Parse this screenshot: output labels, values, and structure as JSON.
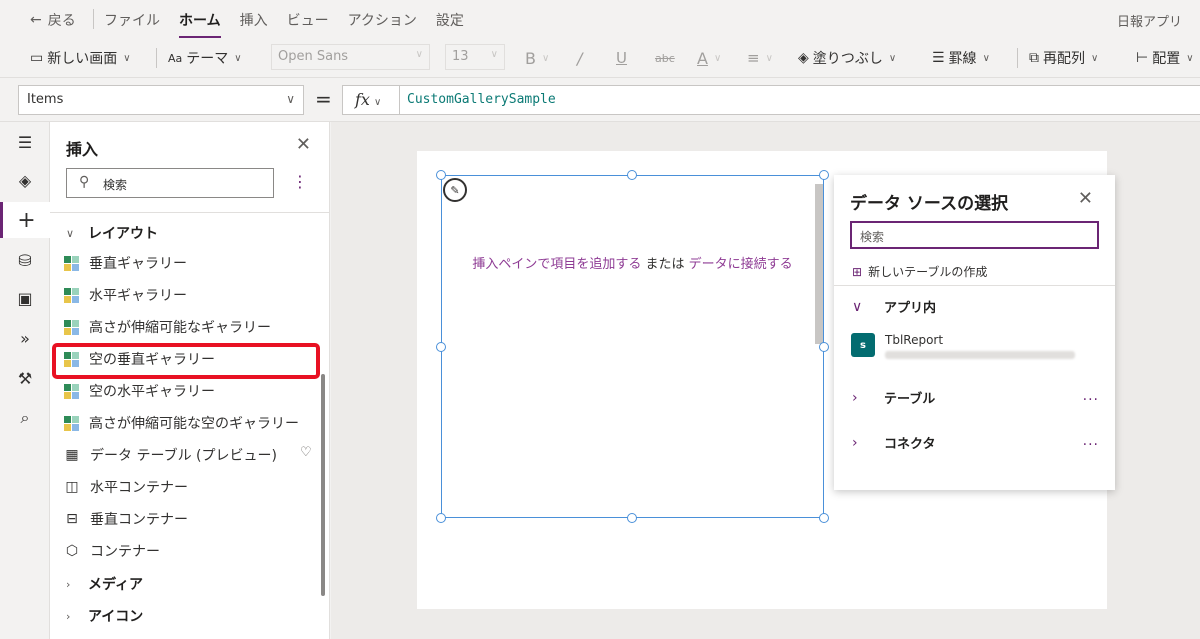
{
  "menubar": {
    "back_label": "戻る",
    "items": [
      "ファイル",
      "ホーム",
      "挿入",
      "ビュー",
      "アクション",
      "設定"
    ],
    "active": "ホーム",
    "app_name": "日報アプリ"
  },
  "toolbar": {
    "new_screen": "新しい画面",
    "theme": "テーマ",
    "font_family": "Open Sans",
    "font_size": "13",
    "fill": "塗りつぶし",
    "border": "罫線",
    "reorder": "再配列",
    "align": "配置"
  },
  "formula_bar": {
    "property": "Items",
    "equals": "=",
    "fx_label": "fx",
    "formula": "CustomGallerySample"
  },
  "insert_panel": {
    "title": "挿入",
    "search_placeholder": "検索",
    "groups": {
      "layout": "レイアウト",
      "media": "メディア",
      "icons": "アイコン"
    },
    "items": [
      "垂直ギャラリー",
      "水平ギャラリー",
      "高さが伸縮可能なギャラリー",
      "空の垂直ギャラリー",
      "空の水平ギャラリー",
      "高さが伸縮可能な空のギャラリー",
      "データ テーブル (プレビュー)",
      "水平コンテナー",
      "垂直コンテナー",
      "コンテナー"
    ],
    "highlighted_item": "空の垂直ギャラリー"
  },
  "gallery": {
    "prompt_link1": "挿入ペインで項目を追加する",
    "prompt_mid": " または ",
    "prompt_link2": "データに接続する"
  },
  "data_source_panel": {
    "title": "データ ソースの選択",
    "search_placeholder": "検索",
    "new_table": "新しいテーブルの作成",
    "in_app": "アプリ内",
    "source_name": "TblReport",
    "source_icon_letter": "s",
    "tables": "テーブル",
    "connectors": "コネクタ",
    "more": "..."
  },
  "colors": {
    "accent": "#6b2574",
    "selection": "#4a90d9",
    "highlight_box": "#e81123",
    "formula_text": "#0b7a75"
  }
}
